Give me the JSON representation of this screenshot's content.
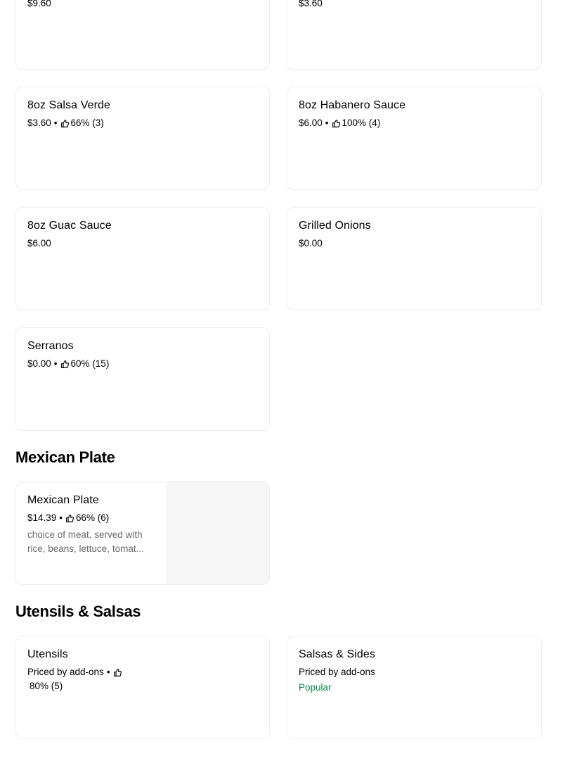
{
  "top_row": [
    {
      "price": "$9.60"
    },
    {
      "price": "$3.60"
    }
  ],
  "items": [
    {
      "title": "8oz Salsa Verde",
      "price": "$3.60",
      "rating": "66% (3)"
    },
    {
      "title": "8oz Habanero Sauce",
      "price": "$6.00",
      "rating": "100% (4)"
    },
    {
      "title": "8oz Guac Sauce",
      "price": "$6.00"
    },
    {
      "title": "Grilled Onions",
      "price": "$0.00"
    },
    {
      "title": "Serranos",
      "price": "$0.00",
      "rating": "60% (15)"
    }
  ],
  "sections": {
    "mexican_plate": "Mexican Plate",
    "utensils_salsas": "Utensils & Salsas"
  },
  "mexican_plate_item": {
    "title": "Mexican Plate",
    "price": "$14.39",
    "rating": "66% (6)",
    "description": "choice of meat, served with rice, beans, lettuce, tomat..."
  },
  "utensils": {
    "title": "Utensils",
    "price": "Priced by add-ons",
    "rating": "80% (5)"
  },
  "salsas_sides": {
    "title": "Salsas & Sides",
    "price": "Priced by add-ons",
    "badge": "Popular"
  },
  "colors": {
    "popular": "#0e8345",
    "border": "#eeeeee",
    "description": "#6b6b6b"
  },
  "icons": {
    "rating": "thumbs-up-icon"
  }
}
